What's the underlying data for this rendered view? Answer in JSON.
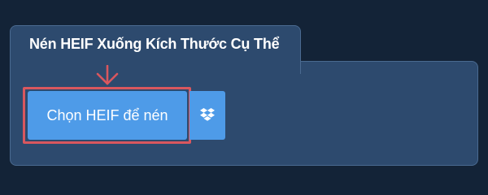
{
  "tab": {
    "title": "Nén HEIF Xuống Kích Thước Cụ Thể"
  },
  "upload": {
    "choose_label": "Chọn HEIF để nén",
    "dropbox_icon": "dropbox-icon"
  },
  "colors": {
    "page_background": "#132337",
    "panel_background": "#2d4a6e",
    "button_background": "#4e9be8",
    "highlight_border": "#d9575e",
    "text": "#ffffff"
  }
}
